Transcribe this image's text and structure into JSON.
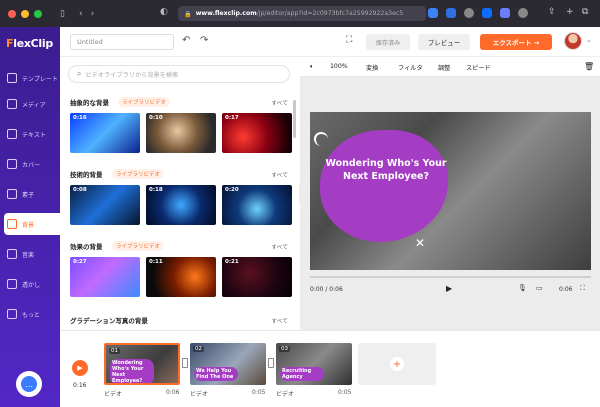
{
  "browser": {
    "url_host": "www.flexclip.com",
    "url_path": "/jp/editor/app?id=2c0973bfc7a25992922a3ec5",
    "back_icon": "chevron-left-icon",
    "forward_icon": "chevron-right-icon"
  },
  "brand": {
    "logo_prefix": "F",
    "logo_x": "",
    "logo_text": "lexClip",
    "accent": "#ff6a2b",
    "nav_bg": "#4a22b8"
  },
  "nav": {
    "items": [
      {
        "label": "テンプレート",
        "icon": "template-icon"
      },
      {
        "label": "メディア",
        "icon": "media-folder-icon"
      },
      {
        "label": "テキスト",
        "icon": "text-icon"
      },
      {
        "label": "カバー",
        "icon": "cover-icon"
      },
      {
        "label": "素子",
        "icon": "elements-icon"
      },
      {
        "label": "背景",
        "icon": "background-icon",
        "active": true
      },
      {
        "label": "音楽",
        "icon": "music-icon"
      },
      {
        "label": "透かし",
        "icon": "watermark-icon"
      },
      {
        "label": "もっと",
        "icon": "more-icon"
      }
    ]
  },
  "toolbar": {
    "project_name_placeholder": "Untitled",
    "save_label": "保存済み",
    "preview_label": "プレビュー",
    "export_label": "エクスポート →"
  },
  "library": {
    "search_placeholder": "ビデオライブラリから背景を検索",
    "sections": [
      {
        "title": "抽象的な背景",
        "tag": "ライブラリビデオ",
        "see_all": "すべて",
        "durations": [
          "0:16",
          "0:10",
          "0:17"
        ]
      },
      {
        "title": "技術的背景",
        "tag": "ライブラリビデオ",
        "see_all": "すべて",
        "durations": [
          "0:08",
          "0:18",
          "0:20"
        ]
      },
      {
        "title": "効果の背景",
        "tag": "ライブラリビデオ",
        "see_all": "すべて",
        "durations": [
          "0:27",
          "0:11",
          "0:21"
        ]
      },
      {
        "title": "グラデーション写真の背景",
        "tag": "",
        "see_all": "すべて",
        "durations": []
      }
    ]
  },
  "preview": {
    "volume": "100%",
    "tools": [
      "変換",
      "フィルタ",
      "調整",
      "スピード"
    ],
    "headline": "Wondering Who's Your Next Employee?",
    "current_time": "0:00 / 0:06",
    "duration": "0:06"
  },
  "timeline": {
    "current_time": "0:16",
    "clips": [
      {
        "num": "01",
        "title": "Wondering Who's Your Next Employee?",
        "label": "ビデオ",
        "duration": "0:06"
      },
      {
        "num": "02",
        "title": "We Help You Find The One",
        "label": "ビデオ",
        "duration": "0:05"
      },
      {
        "num": "03",
        "title": "Recruiting Agency",
        "label": "ビデオ",
        "duration": "0:05"
      }
    ]
  }
}
